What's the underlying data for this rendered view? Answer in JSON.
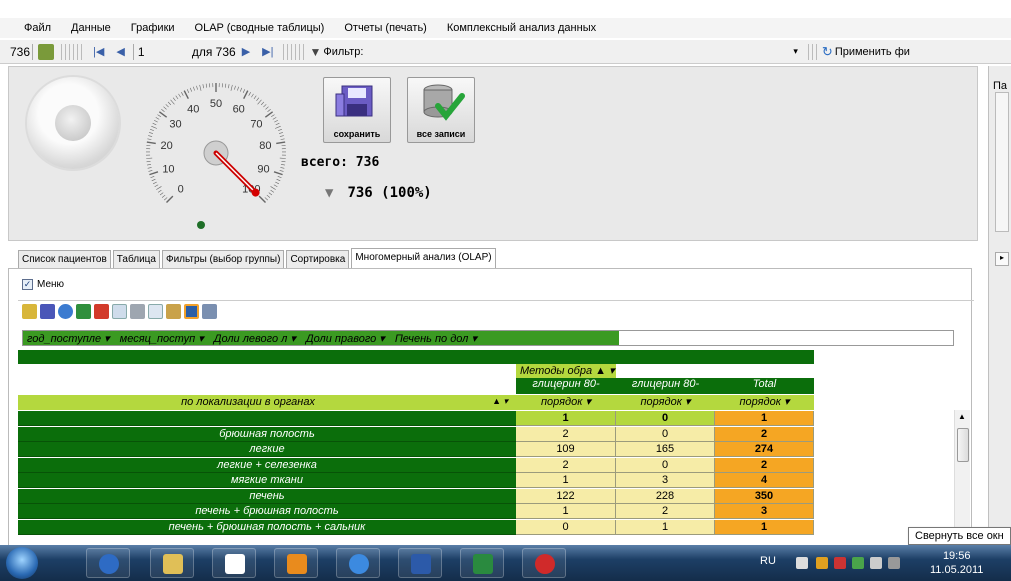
{
  "menu": [
    "Файл",
    "Данные",
    "Графики",
    "OLAP (сводные таблицы)",
    "Отчеты (печать)",
    "Комплексный анализ данных"
  ],
  "navbar": {
    "record_count": "736",
    "current": "1",
    "of_label": "для 736",
    "filter_label": "Фильтр:",
    "apply_label": "Применить фи"
  },
  "gauge": {
    "value": 100,
    "ticks": [
      "0",
      "10",
      "20",
      "30",
      "40",
      "50",
      "60",
      "70",
      "80",
      "90",
      "100"
    ]
  },
  "buttons": {
    "save": "сохранить",
    "all_records": "все записи"
  },
  "stats": {
    "total": "всего: 736",
    "filtered": "736 (100%)"
  },
  "right_panel": {
    "title": "Па"
  },
  "tabs": [
    "Список пациентов",
    "Таблица",
    "Фильтры (выбор группы)",
    "Сортировка",
    "Многомерный анализ (OLAP)"
  ],
  "active_tab": 4,
  "menu_checkbox": "Меню",
  "fields": [
    "год_поступле ▾",
    "месяц_поступ ▾",
    "Доли левого л ▾",
    "Доли правого ▾",
    "Печень по дол ▾"
  ],
  "pivot": {
    "measure_header": "Методы обра ▲ ▾",
    "columns": [
      "глицерин 80-",
      "глицерин 80-",
      "Total"
    ],
    "subheaders": [
      "порядок ▾",
      "порядок ▾",
      "порядок ▾"
    ],
    "row_header": "по локализации в органах",
    "row_header_arrow": "▲ ▾",
    "rows": [
      {
        "label": "",
        "v1": "1",
        "v2": "0",
        "total": "1"
      },
      {
        "label": "брюшная полость",
        "v1": "2",
        "v2": "0",
        "total": "2"
      },
      {
        "label": "легкие",
        "v1": "109",
        "v2": "165",
        "total": "274"
      },
      {
        "label": "легкие + селезенка",
        "v1": "2",
        "v2": "0",
        "total": "2"
      },
      {
        "label": "мягкие ткани",
        "v1": "1",
        "v2": "3",
        "total": "4"
      },
      {
        "label": "печень",
        "v1": "122",
        "v2": "228",
        "total": "350"
      },
      {
        "label": "печень + брюшная полость",
        "v1": "1",
        "v2": "2",
        "total": "3"
      },
      {
        "label": "печень + брюшная полость + сальник",
        "v1": "0",
        "v2": "1",
        "total": "1"
      }
    ]
  },
  "tooltip": "Свернуть все окн",
  "taskbar": {
    "lang": "RU",
    "time": "19:56",
    "date": "11.05.2011"
  }
}
